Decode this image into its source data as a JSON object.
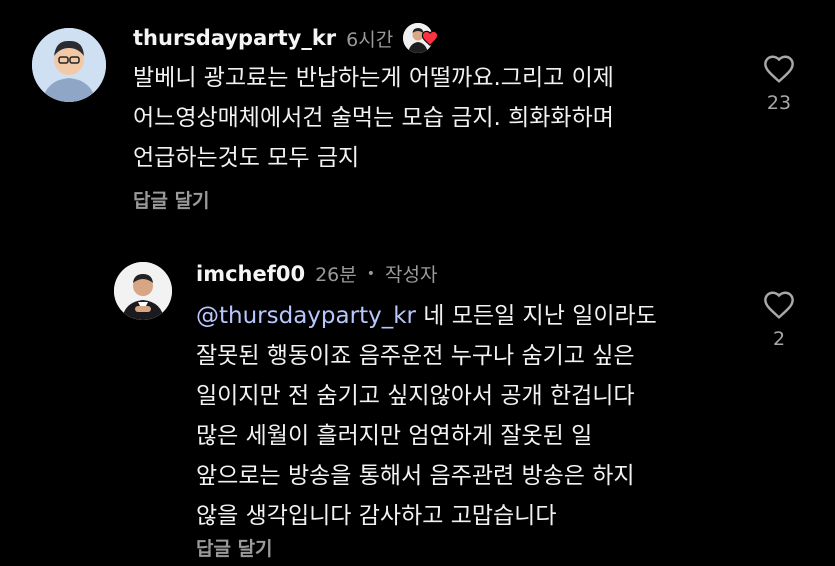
{
  "comments": [
    {
      "username": "thursdayparty_kr",
      "time": "6시간",
      "lines": [
        "발베니 광고료는 반납하는게 어떨까요.그리고 이제",
        "어느영상매체에서건 술먹는 모습 금지. 희화화하며",
        "언급하는것도 모두 금지"
      ],
      "reply_label": "답글 달기",
      "like_count": "23"
    },
    {
      "username": "imchef00",
      "time": "26분",
      "separator": "•",
      "author_label": "작성자",
      "mention": "@thursdayparty_kr",
      "first_line_rest": " 네 모든일 지난 일이라도",
      "lines": [
        "잘못된 행동이죠  음주운전 누구나 숨기고 싶은",
        "일이지만 전 숨기고 싶지않아서 공개 한겁니다",
        "많은 세월이  흘러지만 엄연하게 잘옷된 일",
        "앞으로는 방송을 통해서 음주관련 방송은 하지",
        "않을 생각입니다 감사하고 고맙습니다"
      ],
      "reply_label": "답글 달기",
      "like_count": "2"
    }
  ],
  "colors": {
    "background": "#000000",
    "text": "#f5f5f5",
    "muted": "#9a9a9a",
    "mention": "#b9c7ff",
    "heart_red": "#ff3040"
  },
  "icons": {
    "like": "heart-outline-icon",
    "creator_liked": "red-heart-icon"
  }
}
